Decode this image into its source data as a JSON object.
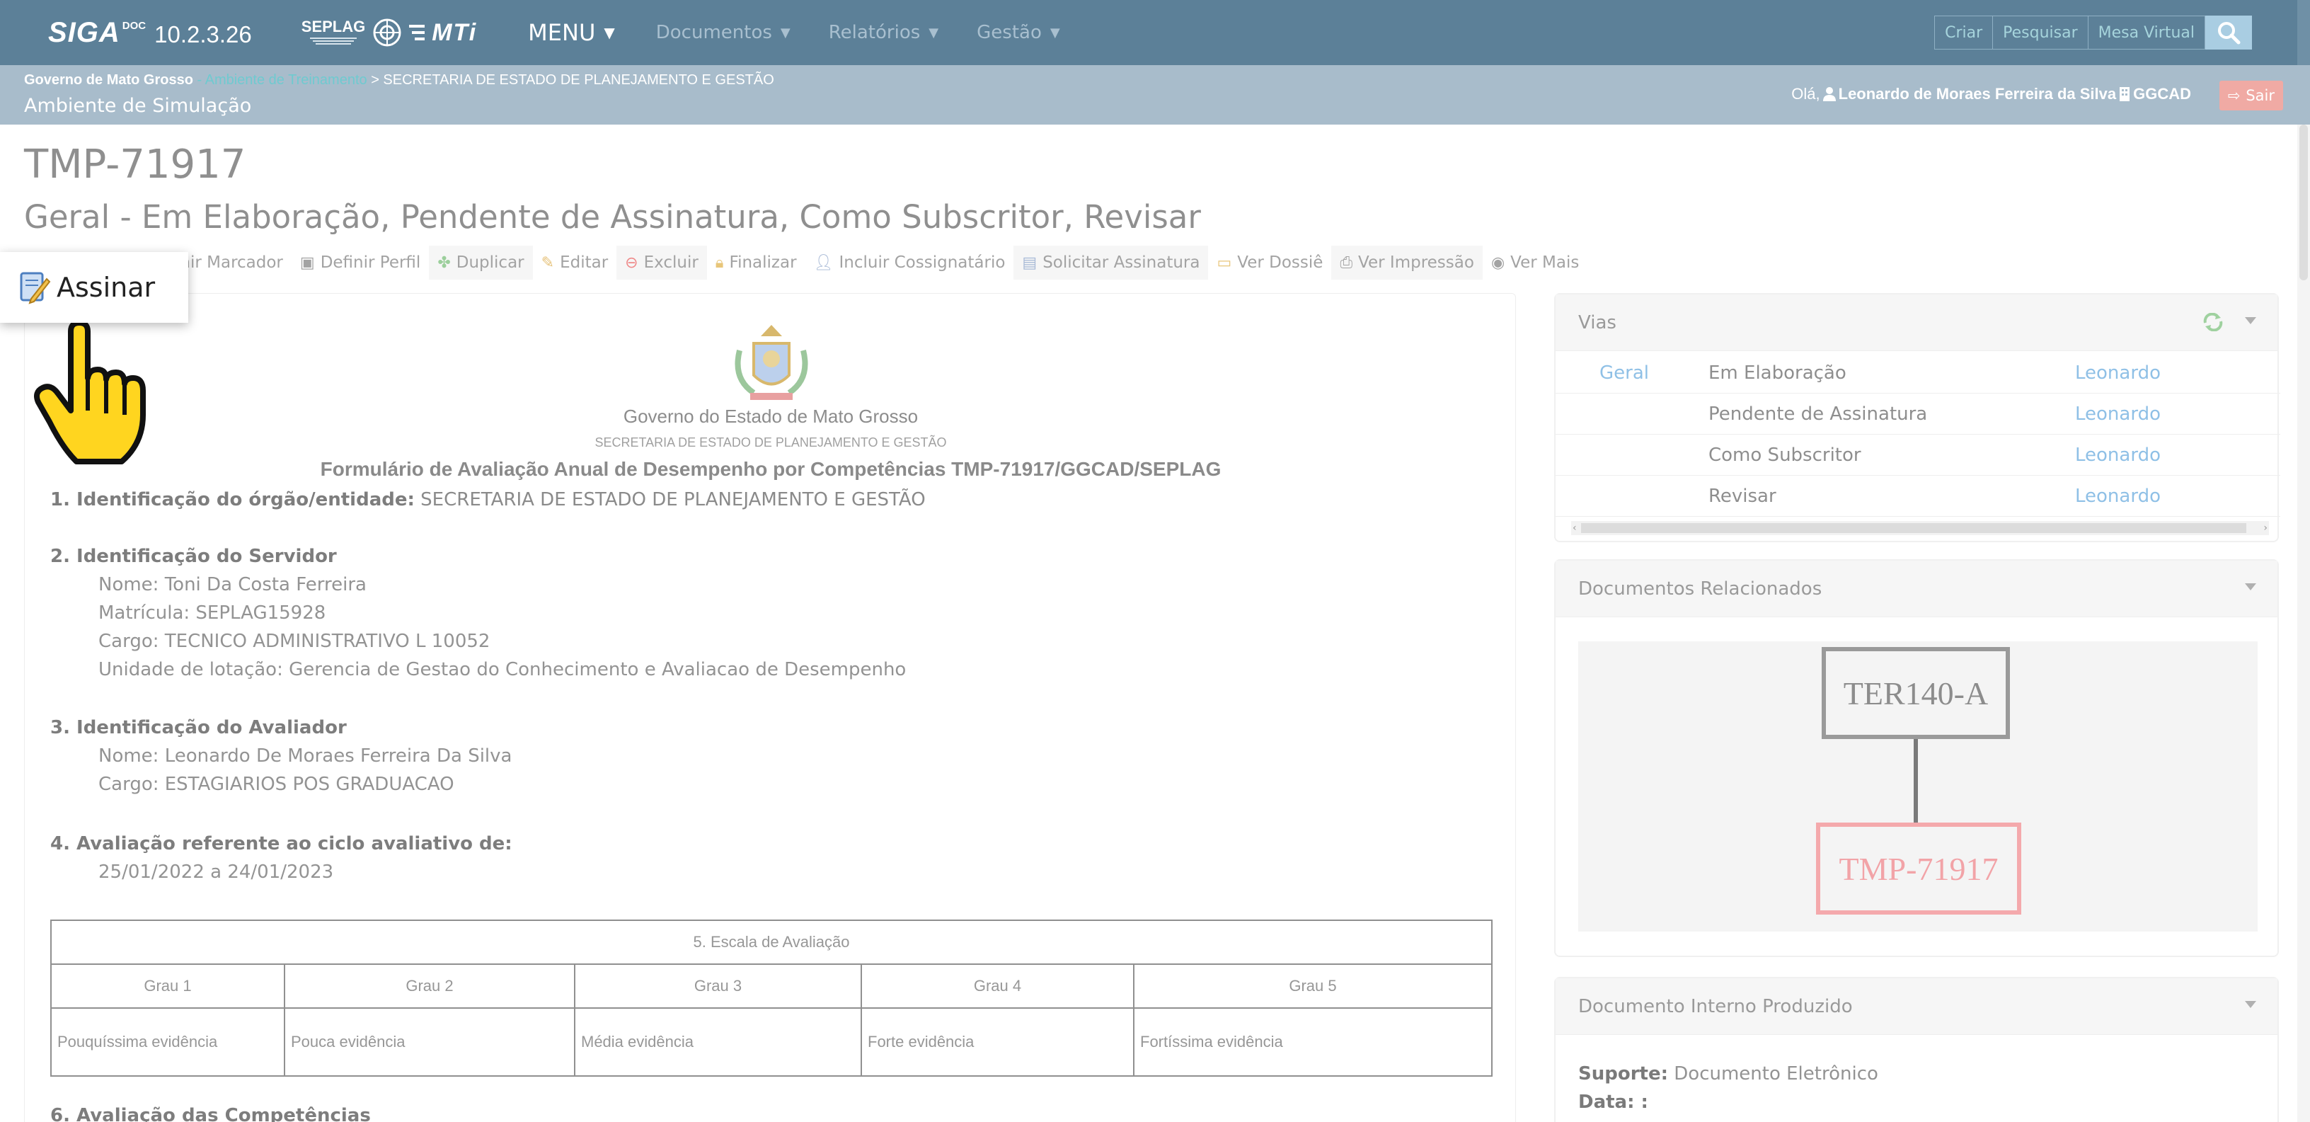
{
  "navbar": {
    "brand": "SIGA",
    "brand_sup": "DOC",
    "version": "10.2.3.26",
    "partner_seplag": "SEPLAG",
    "partner_mti": "MTi",
    "menu_label": "MENU",
    "menu_items": [
      "Documentos",
      "Relatórios",
      "Gestão"
    ],
    "buttons": [
      "Criar",
      "Pesquisar",
      "Mesa Virtual"
    ]
  },
  "subheader": {
    "org": "Governo de Mato Grosso",
    "env": " - Ambiente de Treinamento",
    "crumb": " > SECRETARIA DE ESTADO DE PLANEJAMENTO E GESTÃO",
    "env_title": "Ambiente de Simulação",
    "greeting": "Olá,",
    "user": "Leonardo de Moraes Ferreira da Silva",
    "unit": "GGCAD",
    "logout": "Sair"
  },
  "document": {
    "code": "TMP-71917",
    "status_line": "Geral - Em Elaboração, Pendente de Assinatura, Como Subscritor, Revisar"
  },
  "actions": [
    {
      "icon": "tag-icon",
      "label": "inir Marcador"
    },
    {
      "icon": "profile-icon",
      "label": "Definir Perfil"
    },
    {
      "icon": "duplicate-icon",
      "label": "Duplicar"
    },
    {
      "icon": "pencil-icon",
      "label": "Editar"
    },
    {
      "icon": "delete-icon",
      "label": "Excluir"
    },
    {
      "icon": "lock-icon",
      "label": "Finalizar"
    },
    {
      "icon": "cosigner-icon",
      "label": "Incluir Cossignatário"
    },
    {
      "icon": "request-signature-icon",
      "label": "Solicitar Assinatura"
    },
    {
      "icon": "folder-icon",
      "label": "Ver Dossiê"
    },
    {
      "icon": "printer-icon",
      "label": "Ver Impressão"
    },
    {
      "icon": "eye-icon",
      "label": "Ver Mais"
    }
  ],
  "popup": {
    "label": "Assinar"
  },
  "doc_content": {
    "gov": "Governo do Estado de Mato Grosso",
    "secretaria": "SECRETARIA DE ESTADO DE PLANEJAMENTO E GESTÃO",
    "form_title": "Formulário de Avaliação Anual de Desempenho por Competências TMP-71917/GGCAD/SEPLAG",
    "s1_label": "1. Identificação do órgão/entidade:",
    "s1_value": " SECRETARIA DE ESTADO DE PLANEJAMENTO E GESTÃO",
    "s2_label": "2. Identificação do Servidor",
    "s2_lines": [
      "Nome: Toni Da Costa Ferreira",
      "Matrícula: SEPLAG15928",
      "Cargo: TECNICO ADMINISTRATIVO L 10052",
      "Unidade de lotação: Gerencia de Gestao do Conhecimento e Avaliacao de Desempenho"
    ],
    "s3_label": "3. Identificação do Avaliador",
    "s3_lines": [
      "Nome: Leonardo De Moraes Ferreira Da Silva",
      "Cargo: ESTAGIARIOS POS GRADUACAO"
    ],
    "s4_label": "4. Avaliação referente ao ciclo avaliativo de:",
    "s4_line": "25/01/2022 a 24/01/2023",
    "scale_title": "5. Escala de Avaliação",
    "scale_grades": [
      "Grau 1",
      "Grau 2",
      "Grau 3",
      "Grau 4",
      "Grau 5"
    ],
    "scale_desc": [
      "Pouquíssima evidência",
      "Pouca evidência",
      "Média evidência",
      "Forte evidência",
      "Fortíssima evidência"
    ],
    "s6_label": "6. Avaliação das Competências"
  },
  "vias": {
    "title": "Vias",
    "rows": [
      {
        "name": "Geral",
        "status": "Em Elaboração",
        "user": "Leonardo"
      },
      {
        "name": "",
        "status": "Pendente de Assinatura",
        "user": "Leonardo"
      },
      {
        "name": "",
        "status": "Como Subscritor",
        "user": "Leonardo"
      },
      {
        "name": "",
        "status": "Revisar",
        "user": "Leonardo"
      }
    ]
  },
  "related": {
    "title": "Documentos Relacionados",
    "parent": "TER140-A",
    "child": "TMP-71917"
  },
  "produced": {
    "title": "Documento Interno Produzido",
    "suporte_label": "Suporte:",
    "suporte_value": " Documento Eletrônico",
    "data_label": "Data: :",
    "data_value": ""
  },
  "colors": {
    "navbar": "#5c8098",
    "subheader": "#a8bccb",
    "link": "#8fc0e6",
    "logout": "#f0aaa4",
    "current_node": "#f4a9ac"
  }
}
